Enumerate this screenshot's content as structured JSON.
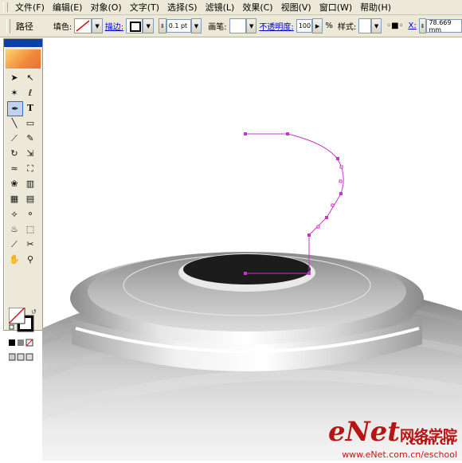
{
  "menu": [
    "文件(F)",
    "编辑(E)",
    "对象(O)",
    "文字(T)",
    "选择(S)",
    "滤镜(L)",
    "效果(C)",
    "视图(V)",
    "窗口(W)",
    "帮助(H)"
  ],
  "control": {
    "selection_label": "路径",
    "fill_label": "填色:",
    "stroke_label": "描边:",
    "stroke_weight": "0.1 pt",
    "brush_label": "画笔:",
    "opacity_label": "不透明度:",
    "opacity_value": "100",
    "percent": "%",
    "style_label": "样式:",
    "x_label": "X:",
    "x_value": "78.669 mm"
  },
  "colors": {
    "path": "#cc33cc",
    "ui_bg": "#ece9d8",
    "accent": "#316ac5"
  },
  "tools": [
    "selection-tool",
    "direct-selection-tool",
    "magic-wand-tool",
    "lasso-tool",
    "pen-tool",
    "type-tool",
    "line-tool",
    "rectangle-tool",
    "paintbrush-tool",
    "pencil-tool",
    "rotate-tool",
    "scale-tool",
    "warp-tool",
    "free-transform-tool",
    "symbol-sprayer-tool",
    "graph-tool",
    "mesh-tool",
    "gradient-tool",
    "eyedropper-tool",
    "blend-tool",
    "live-paint-tool",
    "live-paint-selection-tool",
    "slice-tool",
    "scissors-tool",
    "hand-tool",
    "zoom-tool"
  ],
  "watermark": {
    "brand": "eNet",
    "cn": "网络学院",
    "domain": ".com.cn",
    "url": "www.eNet.com.cn/eschool"
  }
}
